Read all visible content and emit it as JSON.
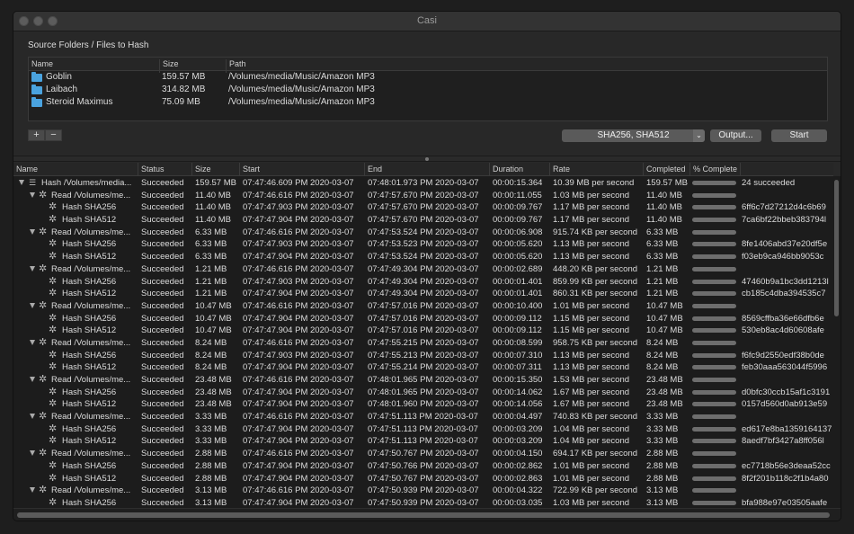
{
  "window": {
    "title": "Casi"
  },
  "source": {
    "label": "Source Folders / Files to Hash",
    "columns": [
      "Name",
      "Size",
      "Path"
    ],
    "rows": [
      {
        "name": "Goblin",
        "size": "159.57 MB",
        "path": "/Volumes/media/Music/Amazon MP3"
      },
      {
        "name": "Laibach",
        "size": "314.82 MB",
        "path": "/Volumes/media/Music/Amazon MP3"
      },
      {
        "name": "Steroid Maximus",
        "size": "75.09 MB",
        "path": "/Volumes/media/Music/Amazon MP3"
      }
    ]
  },
  "controls": {
    "add_label": "+",
    "remove_label": "−",
    "algorithms": "SHA256, SHA512",
    "output_label": "Output...",
    "start_label": "Start",
    "select_arrow": "⌄"
  },
  "results": {
    "columns": [
      "Name",
      "Status",
      "Size",
      "Start",
      "End",
      "Duration",
      "Rate",
      "Completed",
      "% Complete"
    ],
    "rows": [
      {
        "level": 0,
        "kind": "hash",
        "name": "Hash /Volumes/media...",
        "status": "Succeeded",
        "size": "159.57 MB",
        "start": "07:47:46.609 PM 2020-03-07",
        "end": "07:48:01.973 PM 2020-03-07",
        "duration": "00:00:15.364",
        "rate": "10.39 MB per second",
        "completed": "159.57 MB",
        "extra": "24 succeeded"
      },
      {
        "level": 1,
        "kind": "read",
        "name": "Read /Volumes/me...",
        "status": "Succeeded",
        "size": "11.40 MB",
        "start": "07:47:46.616 PM 2020-03-07",
        "end": "07:47:57.670 PM 2020-03-07",
        "duration": "00:00:11.055",
        "rate": "1.03 MB per second",
        "completed": "11.40 MB",
        "extra": ""
      },
      {
        "level": 2,
        "kind": "leaf",
        "name": "Hash SHA256",
        "status": "Succeeded",
        "size": "11.40 MB",
        "start": "07:47:47.903 PM 2020-03-07",
        "end": "07:47:57.670 PM 2020-03-07",
        "duration": "00:00:09.767",
        "rate": "1.17 MB per second",
        "completed": "11.40 MB",
        "extra": "6ff6c7d27212d4c6b69"
      },
      {
        "level": 2,
        "kind": "leaf",
        "name": "Hash SHA512",
        "status": "Succeeded",
        "size": "11.40 MB",
        "start": "07:47:47.904 PM 2020-03-07",
        "end": "07:47:57.670 PM 2020-03-07",
        "duration": "00:00:09.767",
        "rate": "1.17 MB per second",
        "completed": "11.40 MB",
        "extra": "7ca6bf22bbeb383794l"
      },
      {
        "level": 1,
        "kind": "read",
        "name": "Read /Volumes/me...",
        "status": "Succeeded",
        "size": "6.33 MB",
        "start": "07:47:46.616 PM 2020-03-07",
        "end": "07:47:53.524 PM 2020-03-07",
        "duration": "00:00:06.908",
        "rate": "915.74 KB per second",
        "completed": "6.33 MB",
        "extra": ""
      },
      {
        "level": 2,
        "kind": "leaf",
        "name": "Hash SHA256",
        "status": "Succeeded",
        "size": "6.33 MB",
        "start": "07:47:47.903 PM 2020-03-07",
        "end": "07:47:53.523 PM 2020-03-07",
        "duration": "00:00:05.620",
        "rate": "1.13 MB per second",
        "completed": "6.33 MB",
        "extra": "8fe1406abd37e20df5e"
      },
      {
        "level": 2,
        "kind": "leaf",
        "name": "Hash SHA512",
        "status": "Succeeded",
        "size": "6.33 MB",
        "start": "07:47:47.904 PM 2020-03-07",
        "end": "07:47:53.524 PM 2020-03-07",
        "duration": "00:00:05.620",
        "rate": "1.13 MB per second",
        "completed": "6.33 MB",
        "extra": "f03eb9ca946bb9053c"
      },
      {
        "level": 1,
        "kind": "read",
        "name": "Read /Volumes/me...",
        "status": "Succeeded",
        "size": "1.21 MB",
        "start": "07:47:46.616 PM 2020-03-07",
        "end": "07:47:49.304 PM 2020-03-07",
        "duration": "00:00:02.689",
        "rate": "448.20 KB per second",
        "completed": "1.21 MB",
        "extra": ""
      },
      {
        "level": 2,
        "kind": "leaf",
        "name": "Hash SHA256",
        "status": "Succeeded",
        "size": "1.21 MB",
        "start": "07:47:47.903 PM 2020-03-07",
        "end": "07:47:49.304 PM 2020-03-07",
        "duration": "00:00:01.401",
        "rate": "859.99 KB per second",
        "completed": "1.21 MB",
        "extra": "47460b9a1bc3dd1213l"
      },
      {
        "level": 2,
        "kind": "leaf",
        "name": "Hash SHA512",
        "status": "Succeeded",
        "size": "1.21 MB",
        "start": "07:47:47.904 PM 2020-03-07",
        "end": "07:47:49.304 PM 2020-03-07",
        "duration": "00:00:01.401",
        "rate": "860.31 KB per second",
        "completed": "1.21 MB",
        "extra": "cb185c4dba394535c7"
      },
      {
        "level": 1,
        "kind": "read",
        "name": "Read /Volumes/me...",
        "status": "Succeeded",
        "size": "10.47 MB",
        "start": "07:47:46.616 PM 2020-03-07",
        "end": "07:47:57.016 PM 2020-03-07",
        "duration": "00:00:10.400",
        "rate": "1.01 MB per second",
        "completed": "10.47 MB",
        "extra": ""
      },
      {
        "level": 2,
        "kind": "leaf",
        "name": "Hash SHA256",
        "status": "Succeeded",
        "size": "10.47 MB",
        "start": "07:47:47.904 PM 2020-03-07",
        "end": "07:47:57.016 PM 2020-03-07",
        "duration": "00:00:09.112",
        "rate": "1.15 MB per second",
        "completed": "10.47 MB",
        "extra": "8569cffba36e66dfb6e"
      },
      {
        "level": 2,
        "kind": "leaf",
        "name": "Hash SHA512",
        "status": "Succeeded",
        "size": "10.47 MB",
        "start": "07:47:47.904 PM 2020-03-07",
        "end": "07:47:57.016 PM 2020-03-07",
        "duration": "00:00:09.112",
        "rate": "1.15 MB per second",
        "completed": "10.47 MB",
        "extra": "530eb8ac4d60608afe"
      },
      {
        "level": 1,
        "kind": "read",
        "name": "Read /Volumes/me...",
        "status": "Succeeded",
        "size": "8.24 MB",
        "start": "07:47:46.616 PM 2020-03-07",
        "end": "07:47:55.215 PM 2020-03-07",
        "duration": "00:00:08.599",
        "rate": "958.75 KB per second",
        "completed": "8.24 MB",
        "extra": ""
      },
      {
        "level": 2,
        "kind": "leaf",
        "name": "Hash SHA256",
        "status": "Succeeded",
        "size": "8.24 MB",
        "start": "07:47:47.903 PM 2020-03-07",
        "end": "07:47:55.213 PM 2020-03-07",
        "duration": "00:00:07.310",
        "rate": "1.13 MB per second",
        "completed": "8.24 MB",
        "extra": "f6fc9d2550edf38b0de"
      },
      {
        "level": 2,
        "kind": "leaf",
        "name": "Hash SHA512",
        "status": "Succeeded",
        "size": "8.24 MB",
        "start": "07:47:47.904 PM 2020-03-07",
        "end": "07:47:55.214 PM 2020-03-07",
        "duration": "00:00:07.311",
        "rate": "1.13 MB per second",
        "completed": "8.24 MB",
        "extra": "feb30aaa563044f5996"
      },
      {
        "level": 1,
        "kind": "read",
        "name": "Read /Volumes/me...",
        "status": "Succeeded",
        "size": "23.48 MB",
        "start": "07:47:46.616 PM 2020-03-07",
        "end": "07:48:01.965 PM 2020-03-07",
        "duration": "00:00:15.350",
        "rate": "1.53 MB per second",
        "completed": "23.48 MB",
        "extra": ""
      },
      {
        "level": 2,
        "kind": "leaf",
        "name": "Hash SHA256",
        "status": "Succeeded",
        "size": "23.48 MB",
        "start": "07:47:47.904 PM 2020-03-07",
        "end": "07:48:01.965 PM 2020-03-07",
        "duration": "00:00:14.062",
        "rate": "1.67 MB per second",
        "completed": "23.48 MB",
        "extra": "d0bfc30ccb15af1c3191"
      },
      {
        "level": 2,
        "kind": "leaf",
        "name": "Hash SHA512",
        "status": "Succeeded",
        "size": "23.48 MB",
        "start": "07:47:47.904 PM 2020-03-07",
        "end": "07:48:01.960 PM 2020-03-07",
        "duration": "00:00:14.056",
        "rate": "1.67 MB per second",
        "completed": "23.48 MB",
        "extra": "0157d560d0ab913e59"
      },
      {
        "level": 1,
        "kind": "read",
        "name": "Read /Volumes/me...",
        "status": "Succeeded",
        "size": "3.33 MB",
        "start": "07:47:46.616 PM 2020-03-07",
        "end": "07:47:51.113 PM 2020-03-07",
        "duration": "00:00:04.497",
        "rate": "740.83 KB per second",
        "completed": "3.33 MB",
        "extra": ""
      },
      {
        "level": 2,
        "kind": "leaf",
        "name": "Hash SHA256",
        "status": "Succeeded",
        "size": "3.33 MB",
        "start": "07:47:47.904 PM 2020-03-07",
        "end": "07:47:51.113 PM 2020-03-07",
        "duration": "00:00:03.209",
        "rate": "1.04 MB per second",
        "completed": "3.33 MB",
        "extra": "ed617e8ba1359164137"
      },
      {
        "level": 2,
        "kind": "leaf",
        "name": "Hash SHA512",
        "status": "Succeeded",
        "size": "3.33 MB",
        "start": "07:47:47.904 PM 2020-03-07",
        "end": "07:47:51.113 PM 2020-03-07",
        "duration": "00:00:03.209",
        "rate": "1.04 MB per second",
        "completed": "3.33 MB",
        "extra": "8aedf7bf3427a8ff056l"
      },
      {
        "level": 1,
        "kind": "read",
        "name": "Read /Volumes/me...",
        "status": "Succeeded",
        "size": "2.88 MB",
        "start": "07:47:46.616 PM 2020-03-07",
        "end": "07:47:50.767 PM 2020-03-07",
        "duration": "00:00:04.150",
        "rate": "694.17 KB per second",
        "completed": "2.88 MB",
        "extra": ""
      },
      {
        "level": 2,
        "kind": "leaf",
        "name": "Hash SHA256",
        "status": "Succeeded",
        "size": "2.88 MB",
        "start": "07:47:47.904 PM 2020-03-07",
        "end": "07:47:50.766 PM 2020-03-07",
        "duration": "00:00:02.862",
        "rate": "1.01 MB per second",
        "completed": "2.88 MB",
        "extra": "ec7718b56e3deaa52cc"
      },
      {
        "level": 2,
        "kind": "leaf",
        "name": "Hash SHA512",
        "status": "Succeeded",
        "size": "2.88 MB",
        "start": "07:47:47.904 PM 2020-03-07",
        "end": "07:47:50.767 PM 2020-03-07",
        "duration": "00:00:02.863",
        "rate": "1.01 MB per second",
        "completed": "2.88 MB",
        "extra": "8f2f201b118c2f1b4a80"
      },
      {
        "level": 1,
        "kind": "read",
        "name": "Read /Volumes/me...",
        "status": "Succeeded",
        "size": "3.13 MB",
        "start": "07:47:46.616 PM 2020-03-07",
        "end": "07:47:50.939 PM 2020-03-07",
        "duration": "00:00:04.322",
        "rate": "722.99 KB per second",
        "completed": "3.13 MB",
        "extra": ""
      },
      {
        "level": 2,
        "kind": "leaf",
        "name": "Hash SHA256",
        "status": "Succeeded",
        "size": "3.13 MB",
        "start": "07:47:47.904 PM 2020-03-07",
        "end": "07:47:50.939 PM 2020-03-07",
        "duration": "00:00:03.035",
        "rate": "1.03 MB per second",
        "completed": "3.13 MB",
        "extra": "bfa988e97e03505aafe"
      }
    ]
  }
}
